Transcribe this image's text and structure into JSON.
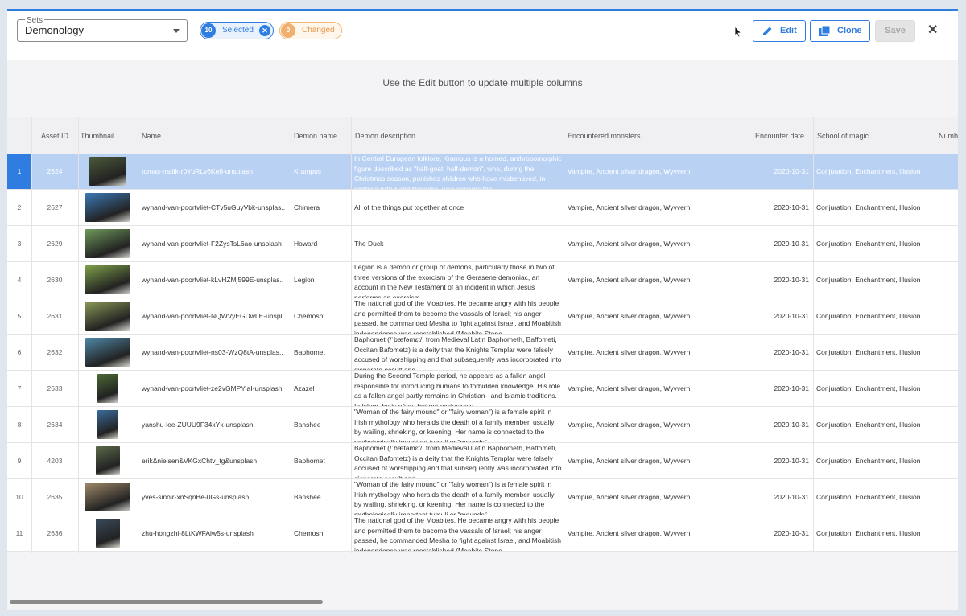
{
  "toolbar": {
    "sets_label": "Sets",
    "set_value": "Demonology",
    "selected_count": "10",
    "selected_label": "Selected",
    "changed_count": "0",
    "changed_label": "Changed",
    "edit_label": "Edit",
    "clone_label": "Clone",
    "save_label": "Save",
    "close_symbol": "✕"
  },
  "hint": "Use the Edit button to update multiple columns",
  "columns": {
    "asset_id": "Asset ID",
    "thumbnail": "Thumbnail",
    "name": "Name",
    "demon_name": "Demon name",
    "demon_description": "Demon description",
    "encountered_monsters": "Encountered monsters",
    "encounter_date": "Encounter date",
    "school_of_magic": "School of magic",
    "number": "Numb"
  },
  "rows": [
    {
      "num": "1",
      "asset_id": "2624",
      "name": "tomas-malik-r0YuRLv6Ke8-unsplash",
      "demon": "Krampus",
      "desc": "In Central European folklore, Krampus is a horned, anthropomorphic figure described as \"half-goat, half-demon\", who, during the Christmas season, punishes children who have misbehaved, in contrast with Saint Nicholas, who rewards the",
      "monsters": "Vampire, Ancient silver dragon, Wyvvern",
      "date": "2020-10-31",
      "school": "Conjuration, Enchantment, Illusion",
      "thumb": "#4a5a3a"
    },
    {
      "num": "2",
      "asset_id": "2627",
      "name": "wynand-van-poortvliet-CTv5uGuyVbk-unsplas..",
      "demon": "Chimera",
      "desc": "All of the things put together at once",
      "monsters": "Vampire, Ancient silver dragon, Wyvvern",
      "date": "2020-10-31",
      "school": "Conjuration, Enchantment, Illusion",
      "thumb": "#3c7ab8"
    },
    {
      "num": "3",
      "asset_id": "2629",
      "name": "wynand-van-poortvliet-F2ZysTsL6ao-unsplash",
      "demon": "Howard",
      "desc": "The Duck",
      "monsters": "Vampire, Ancient silver dragon, Wyvvern",
      "date": "2020-10-31",
      "school": "Conjuration, Enchantment, Illusion",
      "thumb": "#6f9a5a"
    },
    {
      "num": "4",
      "asset_id": "2630",
      "name": "wynand-van-poortvliet-kLvHZMj599E-unsplas..",
      "demon": "Legion",
      "desc": "Legion is a demon or group of demons, particularly those in two of three versions of the exorcism of the Gerasene demoniac, an account in the New Testament of an incident in which Jesus performs an exorcism.",
      "monsters": "Vampire, Ancient silver dragon, Wyvvern",
      "date": "2020-10-31",
      "school": "Conjuration, Enchantment, Illusion",
      "thumb": "#7fa04a"
    },
    {
      "num": "5",
      "asset_id": "2631",
      "name": "wynand-van-poortvliet-NQWVyEGDwLE-unspl..",
      "demon": "Chemosh",
      "desc": "The national god of the Moabites. He became angry with his people and permitted them to become the vassals of Israel; his anger passed, he commanded Mesha to fight against Israel, and Moabitish independence was reestablished (Moabite Stone",
      "monsters": "Vampire, Ancient silver dragon, Wyvvern",
      "date": "2020-10-31",
      "school": "Conjuration, Enchantment, Illusion",
      "thumb": "#8a9a56"
    },
    {
      "num": "6",
      "asset_id": "2632",
      "name": "wynand-van-poortvliet-ns03-WzQ8tA-unsplas..",
      "demon": "Baphomet",
      "desc": "Baphomet (/ˈbæfəmɛt/; from Medieval Latin Baphometh, Baffometi, Occitan Bafometz) is a deity that the Knights Templar were falsely accused of worshipping and that subsequently was incorporated into disparate occult and",
      "monsters": "Vampire, Ancient silver dragon, Wyvvern",
      "date": "2020-10-31",
      "school": "Conjuration, Enchantment, Illusion",
      "thumb": "#4f88a8"
    },
    {
      "num": "7",
      "asset_id": "2633",
      "name": "wynand-van-poortvliet-ze2vGMPYiaI-unsplash",
      "demon": "Azazel",
      "desc": "During the Second Temple period, he appears as a fallen angel responsible for introducing humans to forbidden knowledge. His role as a fallen angel partly remains in Christian– and Islamic traditions. In Islam, he is often, but not exclusively,",
      "monsters": "Vampire, Ancient silver dragon, Wyvvern",
      "date": "2020-10-31",
      "school": "Conjuration, Enchantment, Illusion",
      "thumb": "#4a6a34"
    },
    {
      "num": "8",
      "asset_id": "2634",
      "name": "yanshu-lee-ZUUU9F34xYk-unsplash",
      "demon": "Banshee",
      "desc": "\"Woman of the fairy mound\" or \"fairy woman\") is a female spirit in Irish mythology who heralds the death of a family member, usually by wailing, shrieking, or keening. Her name is connected to the mythologically important tumuli or \"mounds\"",
      "monsters": "Vampire, Ancient silver dragon, Wyvvern",
      "date": "2020-10-31",
      "school": "Conjuration, Enchantment, Illusion",
      "thumb": "#3a6a9a"
    },
    {
      "num": "9",
      "asset_id": "4203",
      "name": "erik&nielsen&VKGxChtv_tg&unsplash",
      "demon": "Baphomet",
      "desc": "Baphomet (/ˈbæfəmɛt/; from Medieval Latin Baphometh, Baffometi, Occitan Bafometz) is a deity that the Knights Templar were falsely accused of worshipping and that subsequently was incorporated into disparate occult and",
      "monsters": "Vampire, Ancient silver dragon, Wyvvern",
      "date": "2020-10-31",
      "school": "Conjuration, Enchantment, Illusion",
      "thumb": "#5a6a4a"
    },
    {
      "num": "10",
      "asset_id": "2635",
      "name": "yves-sinoir-xnSqnBe-0Gs-unsplash",
      "demon": "Banshee",
      "desc": "\"Woman of the fairy mound\" or \"fairy woman\") is a female spirit in Irish mythology who heralds the death of a family member, usually by wailing, shrieking, or keening. Her name is connected to the mythologically important tumuli or \"mounds\"",
      "monsters": "Vampire, Ancient silver dragon, Wyvvern",
      "date": "2020-10-31",
      "school": "Conjuration, Enchantment, Illusion",
      "thumb": "#a08a6a"
    },
    {
      "num": "11",
      "asset_id": "2636",
      "name": "zhu-hongzhi-8LtKWFAiw5s-unsplash",
      "demon": "Chemosh",
      "desc": "The national god of the Moabites. He became angry with his people and permitted them to become the vassals of Israel; his anger passed, he commanded Mesha to fight against Israel, and Moabitish independence was reestablished (Moabite Stone",
      "monsters": "Vampire, Ancient silver dragon, Wyvvern",
      "date": "2020-10-31",
      "school": "Conjuration, Enchantment, Illusion",
      "thumb": "#3a4a5a"
    }
  ]
}
